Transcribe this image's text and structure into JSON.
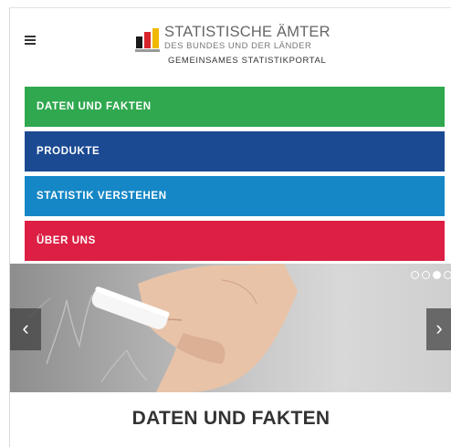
{
  "header": {
    "logo_line1": "STATISTISCHE ÄMTER",
    "logo_line2": "DES BUNDES UND DER LÄNDER",
    "logo_line3": "GEMEINSAMES STATISTIKPORTAL"
  },
  "nav": {
    "items": [
      {
        "label": "DATEN UND FAKTEN",
        "color": "#2fa84f"
      },
      {
        "label": "PRODUKTE",
        "color": "#1b4a93"
      },
      {
        "label": "STATISTIK VERSTEHEN",
        "color": "#1587c6"
      },
      {
        "label": "ÜBER UNS",
        "color": "#dc1f43"
      }
    ]
  },
  "slider": {
    "prev_arrow": "‹",
    "next_arrow": "›",
    "dot_count": 4,
    "active_dot": 3
  },
  "section": {
    "heading": "DATEN UND FAKTEN"
  },
  "icons": [
    "menu-icon",
    "logo-bars-icon",
    "chevron-left-icon",
    "chevron-right-icon"
  ]
}
